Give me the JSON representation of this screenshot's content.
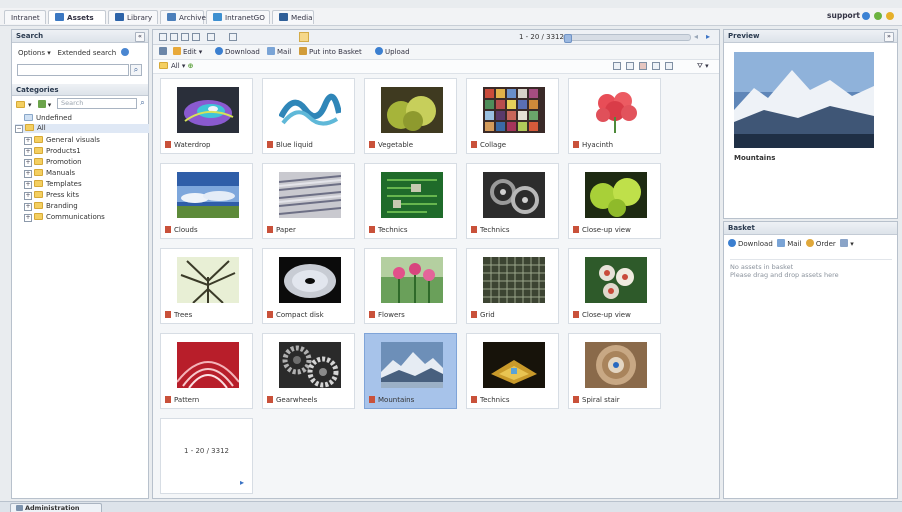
{
  "tabs": [
    "Intranet",
    "Assets",
    "Library",
    "Archive",
    "IntranetGO",
    "Media"
  ],
  "user": "support",
  "search_panel": {
    "title": "Search",
    "options_label": "Options",
    "extended_search_label": "Extended search",
    "input_value": ""
  },
  "categories_panel": {
    "title": "Categories",
    "search_placeholder": "Search",
    "undefined_label": "Undefined",
    "all_label": "All",
    "items": [
      "General visuals",
      "Products1",
      "Promotion",
      "Manuals",
      "Templates",
      "Press kits",
      "Branding",
      "Communications"
    ]
  },
  "toolbar": {
    "pager": "1 - 20 / 3312",
    "edit_label": "Edit",
    "download_label": "Download",
    "mail_label": "Mail",
    "basket_label": "Put into Basket",
    "upload_label": "Upload",
    "filter_label": "All"
  },
  "assets": [
    {
      "name": "Waterdrop"
    },
    {
      "name": "Blue liquid"
    },
    {
      "name": "Vegetable"
    },
    {
      "name": "Collage"
    },
    {
      "name": "Hyacinth"
    },
    {
      "name": "Clouds"
    },
    {
      "name": "Paper"
    },
    {
      "name": "Technics"
    },
    {
      "name": "Technics"
    },
    {
      "name": "Close-up view"
    },
    {
      "name": "Trees"
    },
    {
      "name": "Compact disk"
    },
    {
      "name": "Flowers"
    },
    {
      "name": "Grid"
    },
    {
      "name": "Close-up view"
    },
    {
      "name": "Pattern"
    },
    {
      "name": "Gearwheels"
    },
    {
      "name": "Mountains"
    },
    {
      "name": "Technics"
    },
    {
      "name": "Spiral stair"
    }
  ],
  "pager_tile_text": "1 - 20 / 3312",
  "preview_panel": {
    "title": "Preview",
    "caption": "Mountains"
  },
  "basket_panel": {
    "title": "Basket",
    "download_label": "Download",
    "mail_label": "Mail",
    "order_label": "Order",
    "empty_line1": "No assets in basket",
    "empty_line2": "Please drag and drop assets here"
  },
  "footer": {
    "taskbar_label": "Administration"
  }
}
